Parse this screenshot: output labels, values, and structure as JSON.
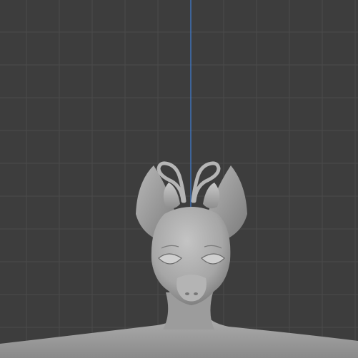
{
  "viewport": {
    "mode": "sculpt-viewport",
    "view": "front-orthographic",
    "background_color": "#3d3d3d",
    "grid_visible": true,
    "grid_line_color": "#4a4a4a",
    "z_axis_visible": true,
    "z_axis_color": "#3f7fd6",
    "object": {
      "kind": "sculpted-creature-bust",
      "features": [
        "heart-shaped-horns",
        "pointed-ears",
        "almond-eyes",
        "snout",
        "neck",
        "shoulders"
      ],
      "material_color": "#a8a8a8"
    }
  }
}
